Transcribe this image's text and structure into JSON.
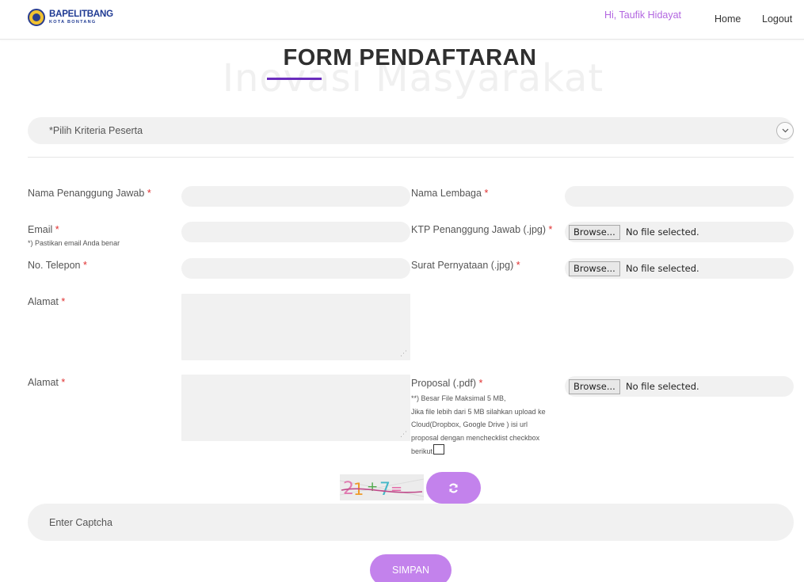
{
  "header": {
    "logo_main": "BAPELITBANG",
    "logo_sub": "KOTA BONTANG",
    "greeting": "Hi, Taufik Hidayat",
    "nav": {
      "home": "Home",
      "logout": "Logout"
    }
  },
  "title": {
    "main": "FORM PENDAFTARAN",
    "background": "Inovasi Masyarakat"
  },
  "criteria_select": {
    "selected": "*Pilih Kriteria Peserta",
    "icon": "chevron-down-icon"
  },
  "form": {
    "required_mark": "*",
    "nama_penanggung_jawab": {
      "label": "Nama Penanggung Jawab",
      "value": ""
    },
    "nama_lembaga": {
      "label": "Nama Lembaga",
      "value": ""
    },
    "email": {
      "label": "Email",
      "note": "*) Pastikan email Anda benar",
      "value": ""
    },
    "ktp": {
      "label": "KTP Penanggung Jawab (.jpg)",
      "browse": "Browse...",
      "status": "No file selected."
    },
    "telepon": {
      "label": "No. Telepon",
      "value": ""
    },
    "surat": {
      "label": "Surat Pernyataan (.jpg)",
      "browse": "Browse...",
      "status": "No file selected."
    },
    "alamat1": {
      "label": "Alamat",
      "value": ""
    },
    "alamat2": {
      "label": "Alamat",
      "value": ""
    },
    "proposal": {
      "label": "Proposal (.pdf)",
      "note_lines": [
        "**) Besar File Maksimal 5 MB,",
        "Jika file lebih dari 5 MB silahkan upload ke",
        "Cloud(Dropbox, Google Drive ) isi url",
        "proposal dengan menchecklist checkbox",
        "berikut"
      ],
      "browse": "Browse...",
      "status": "No file selected.",
      "checkbox_checked": false
    }
  },
  "captcha": {
    "refresh_icon": "refresh-icon",
    "placeholder": "Enter Captcha"
  },
  "submit": {
    "label": "SIMPAN"
  },
  "colors": {
    "accent": "#c382ec",
    "title_underline": "#6a2dbd",
    "greeting": "#b266e0",
    "required": "#e03030",
    "field_bg": "#f1f1f1"
  }
}
